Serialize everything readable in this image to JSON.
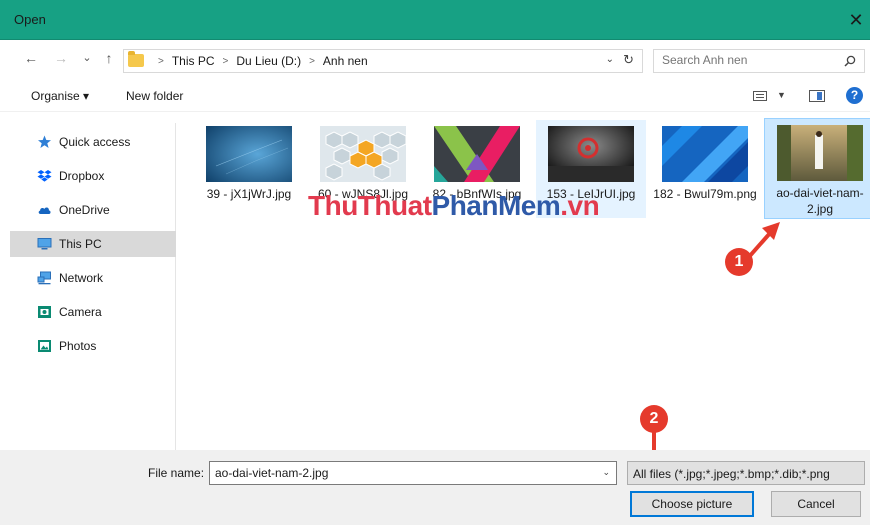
{
  "window": {
    "title": "Open",
    "close": "✕"
  },
  "nav": {
    "back": "←",
    "forward": "→",
    "recent": "⌄",
    "up": "↑",
    "crumbs": [
      "This PC",
      "Du Lieu (D:)",
      "Anh nen"
    ],
    "dropdown": "⌄",
    "refresh": "↻",
    "search_placeholder": "Search Anh nen"
  },
  "toolbar": {
    "organise": "Organise ▾",
    "new_folder": "New folder",
    "view_dropdown": "▼",
    "help": "?"
  },
  "sidebar": {
    "items": [
      {
        "label": "Quick access",
        "icon": "star-icon"
      },
      {
        "label": "Dropbox",
        "icon": "dropbox-icon"
      },
      {
        "label": "OneDrive",
        "icon": "cloud-icon"
      },
      {
        "label": "This PC",
        "icon": "computer-icon",
        "selected": true
      },
      {
        "label": "Network",
        "icon": "network-icon"
      },
      {
        "label": "Camera",
        "icon": "camera-icon"
      },
      {
        "label": "Photos",
        "icon": "photos-icon"
      }
    ]
  },
  "files": [
    {
      "name": "39 - jX1jWrJ.jpg"
    },
    {
      "name": "60 - wJNS8Jl.jpg"
    },
    {
      "name": "82 - bBnfWIs.jpg"
    },
    {
      "name": "153 - LeIJrUI.jpg",
      "hover": true
    },
    {
      "name": "182 - Bwul79m.png"
    },
    {
      "name": "ao-dai-viet-nam-2.jpg",
      "selected": true
    }
  ],
  "watermark": {
    "part1": "ThuThuat",
    "part2": "PhanMem",
    "part3": ".vn"
  },
  "annotations": {
    "badge1": "1",
    "badge2": "2"
  },
  "footer": {
    "filename_label": "File name:",
    "filename_value": "ao-dai-viet-nam-2.jpg",
    "filename_dropdown": "⌄",
    "filter": "All files (*.jpg;*.jpeg;*.bmp;*.dib;*.png",
    "choose": "Choose picture",
    "cancel": "Cancel"
  },
  "colors": {
    "titlebar": "#17a184",
    "selection": "#cce8ff",
    "accent": "#0078d7",
    "badge": "#e53a2c"
  }
}
